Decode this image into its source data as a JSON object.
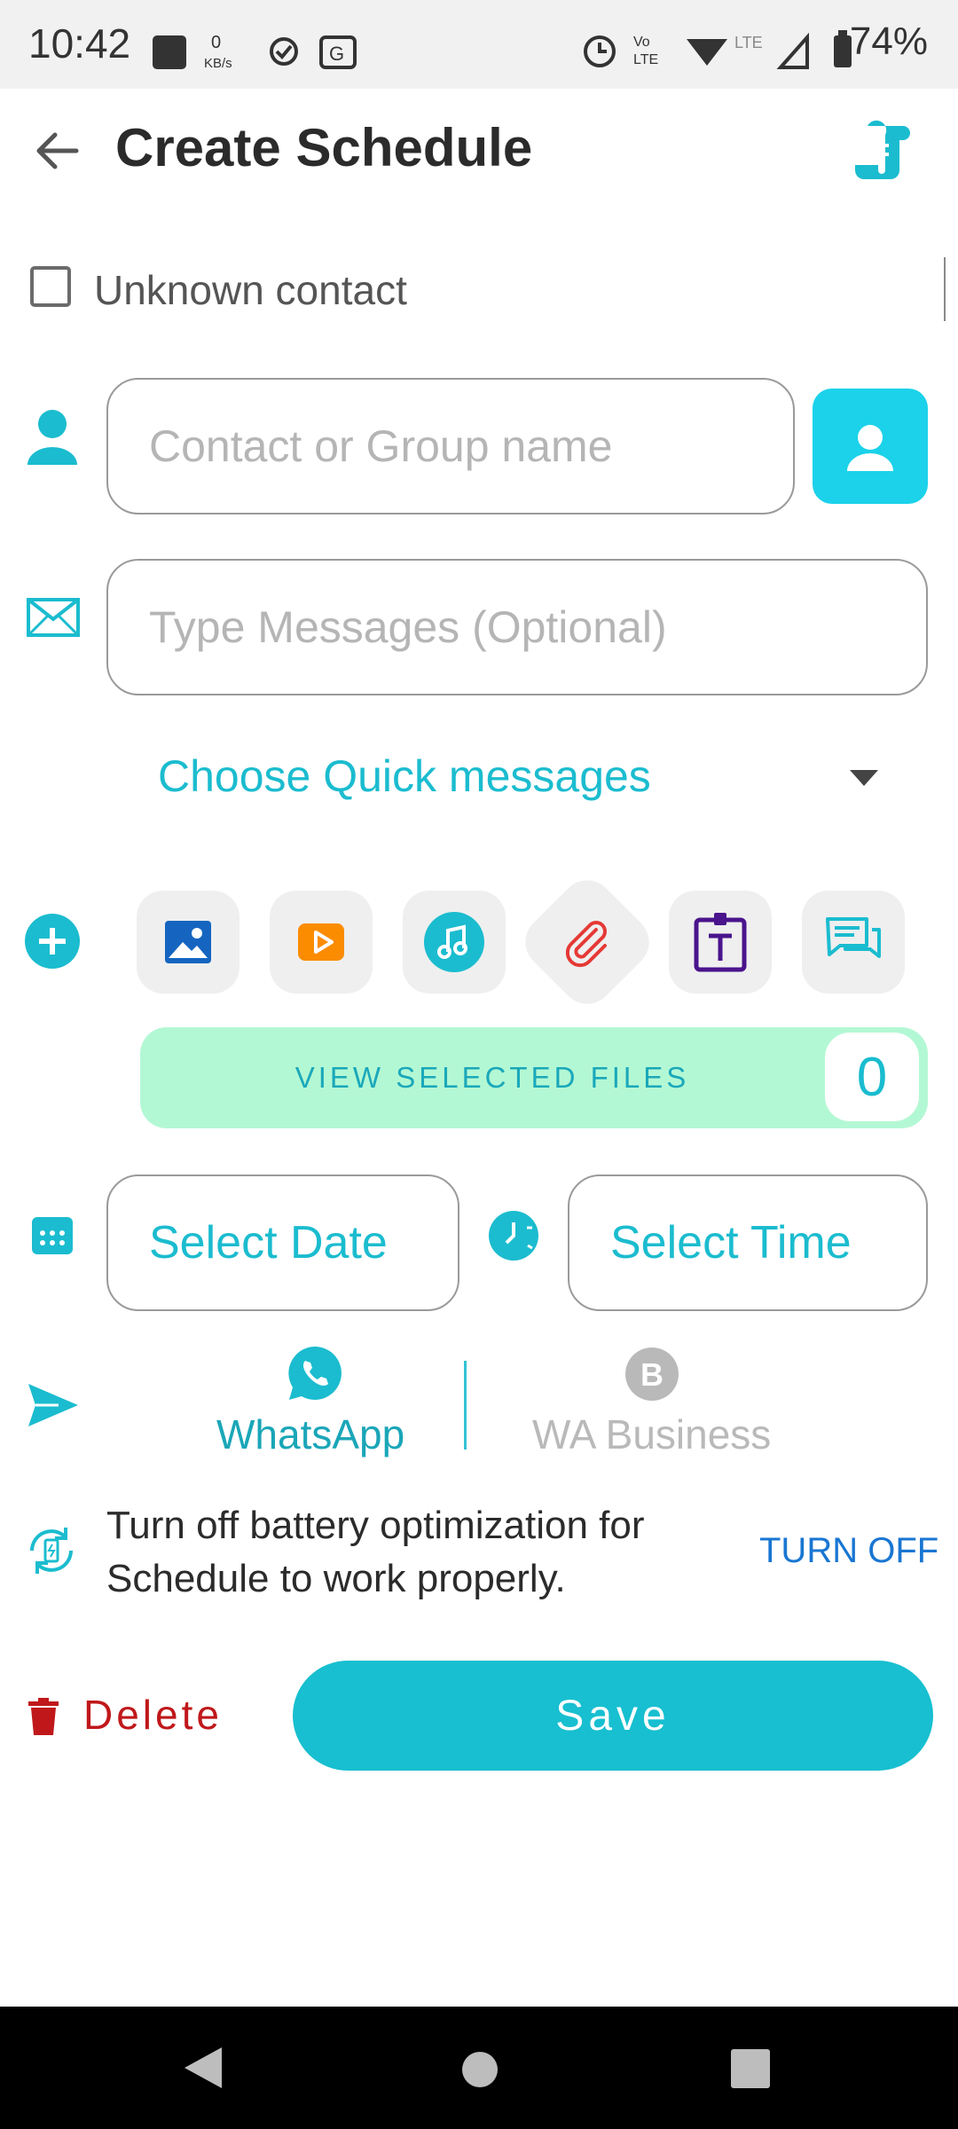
{
  "status_bar": {
    "time": "10:42",
    "battery": "74%"
  },
  "app_bar": {
    "title": "Create Schedule"
  },
  "unknown_contact": {
    "label": "Unknown contact",
    "checked": false
  },
  "contact": {
    "placeholder": "Contact or Group name"
  },
  "message": {
    "placeholder": "Type Messages (Optional)"
  },
  "quick_messages": {
    "label": "Choose Quick messages"
  },
  "attachments": [
    "image-icon",
    "video-icon",
    "audio-icon",
    "file-clip-icon",
    "text-icon",
    "quick-reply-icon"
  ],
  "selected_files": {
    "label": "VIEW SELECTED FILES",
    "count": "0"
  },
  "schedule": {
    "date_label": "Select Date",
    "time_label": "Select Time"
  },
  "send_via": {
    "whatsapp": "WhatsApp",
    "business": "WA Business",
    "selected": "WhatsApp"
  },
  "battery_tip": {
    "text": "Turn off battery optimization for Schedule to work properly.",
    "action": "TURN OFF"
  },
  "actions": {
    "delete": "Delete",
    "save": "Save"
  },
  "colors": {
    "accent": "#17bfd0",
    "delete": "#c0181a",
    "link": "#1976d2",
    "files_bar": "#b3f8d4"
  }
}
